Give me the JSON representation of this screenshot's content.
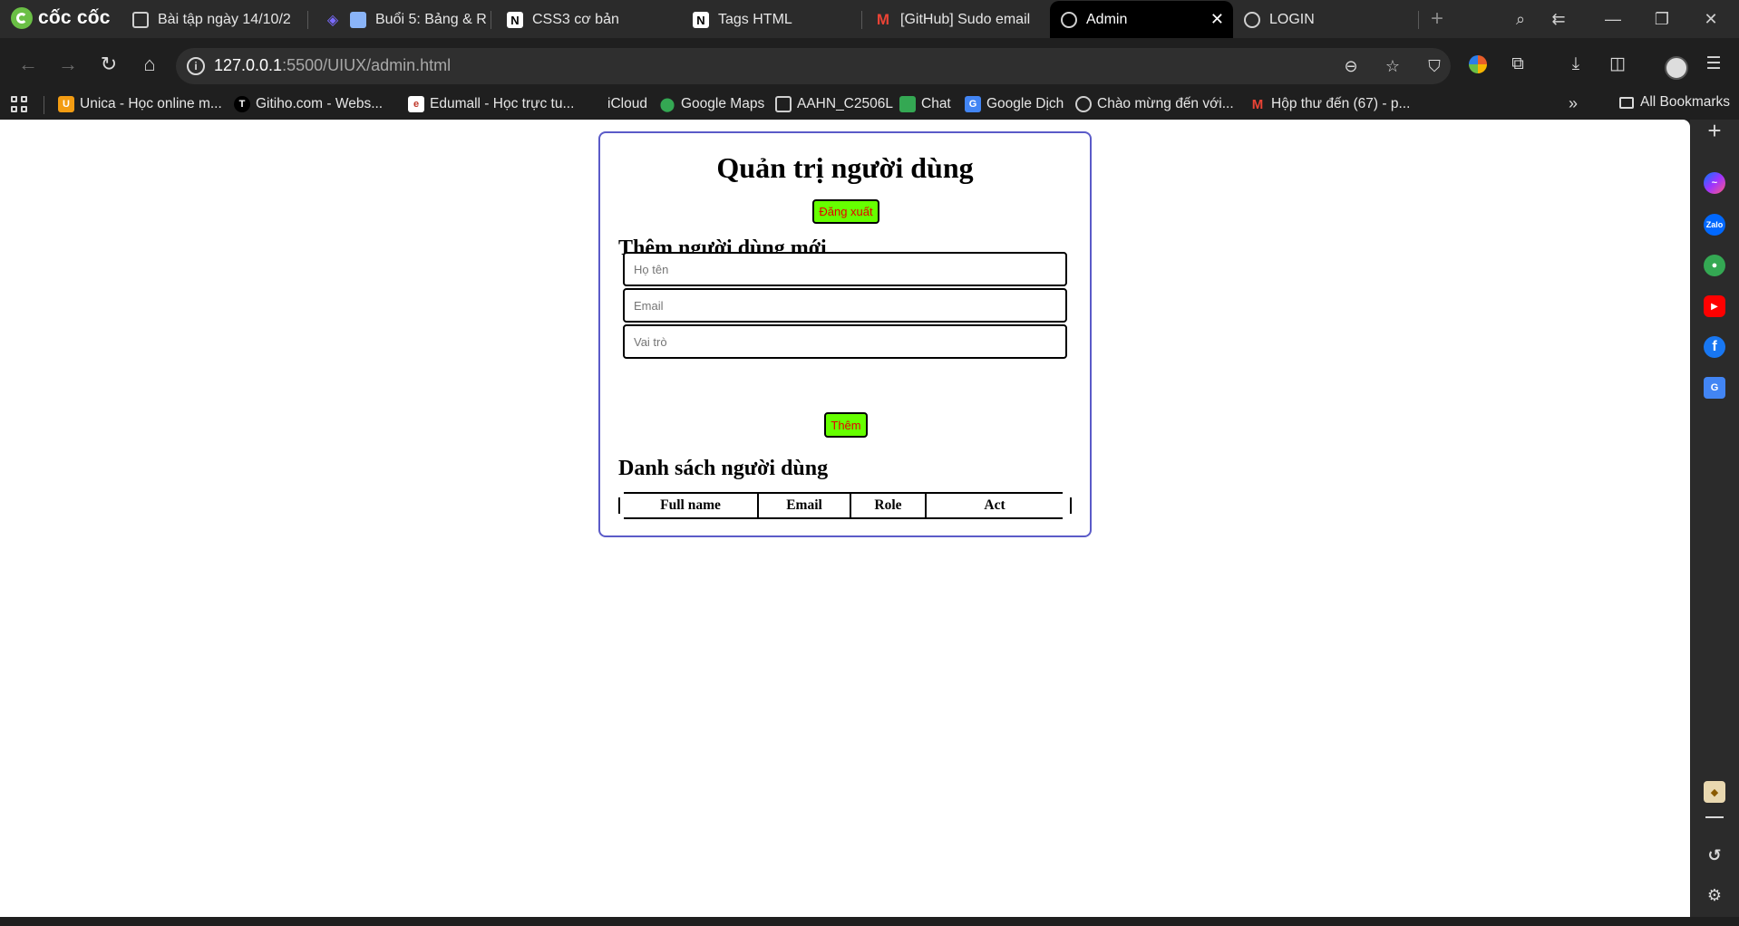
{
  "browser": {
    "brand": "cốc cốc",
    "tabs": [
      {
        "label": "Bài tập ngày 14/10/2",
        "icon": "page-icon",
        "active": false
      },
      {
        "label": "Buổi 5: Bảng & R",
        "icon": "calendar-icon",
        "active": false
      },
      {
        "label": "CSS3 cơ bản",
        "icon": "notion-icon",
        "active": false
      },
      {
        "label": "Tags HTML",
        "icon": "notion-icon",
        "active": false
      },
      {
        "label": "[GitHub] Sudo email",
        "icon": "gmail-icon",
        "active": false
      },
      {
        "label": "Admin",
        "icon": "globe-icon",
        "active": true
      },
      {
        "label": "LOGIN",
        "icon": "globe-icon",
        "active": false
      }
    ],
    "address": {
      "host": "127.0.0.1",
      "rest": ":5500/UIUX/admin.html"
    },
    "bookmarks": [
      {
        "label": "Unica - Học online m...",
        "icon": "unica-icon",
        "color": "#f39c12"
      },
      {
        "label": "Gitiho.com - Webs...",
        "icon": "gitiho-icon",
        "color": "#000000"
      },
      {
        "label": "Edumall - Học trực tu...",
        "icon": "edumall-icon",
        "color": "#ffffff"
      },
      {
        "label": "iCloud",
        "icon": "apple-icon",
        "color": "#999999"
      },
      {
        "label": "Google Maps",
        "icon": "maps-pin-icon",
        "color": "#34a853"
      },
      {
        "label": "AAHN_C2506L",
        "icon": "page-icon",
        "color": "#cfcfcf"
      },
      {
        "label": "Chat",
        "icon": "google-chat-icon",
        "color": "#34a853"
      },
      {
        "label": "Google Dịch",
        "icon": "google-translate-icon",
        "color": "#4285f4"
      },
      {
        "label": "Chào mừng đến với...",
        "icon": "globe-icon",
        "color": "#cfcfcf"
      },
      {
        "label": "Hộp thư đến (67) - p...",
        "icon": "gmail-icon",
        "color": "#ea4335"
      }
    ],
    "all_bookmarks": "All Bookmarks"
  },
  "page": {
    "title": "Quản trị người dùng",
    "logout_label": "Đăng xuất",
    "add_heading": "Thêm người dùng mới",
    "form": {
      "name_placeholder": "Họ tên",
      "email_placeholder": "Email",
      "role_placeholder": "Vai trò",
      "submit_label": "Thêm"
    },
    "list_heading": "Danh sách người dùng",
    "table": {
      "columns": [
        "Full name",
        "Email",
        "Role",
        "Act"
      ],
      "rows": []
    },
    "colors": {
      "button_bg": "#66ff00",
      "button_text": "#e60000",
      "card_border": "#5b5bc8"
    }
  }
}
